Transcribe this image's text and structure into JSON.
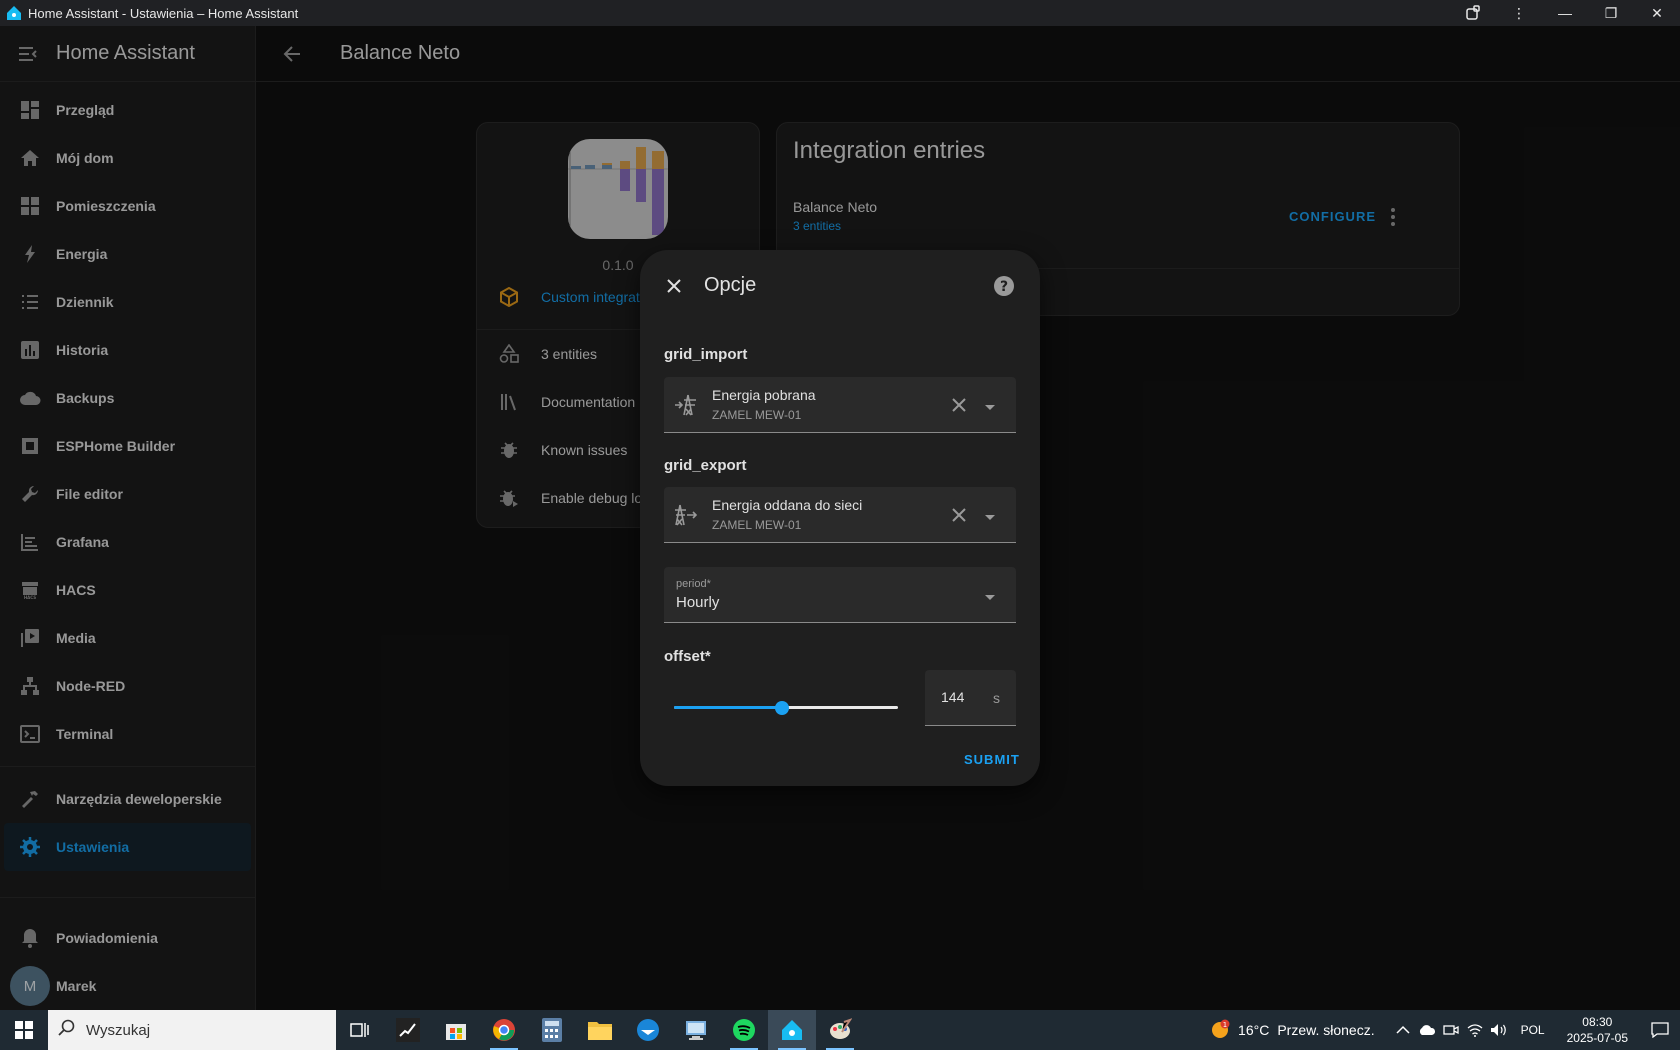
{
  "window": {
    "title": "Home Assistant - Ustawienia – Home Assistant"
  },
  "sidebar": {
    "title": "Home Assistant",
    "items": [
      {
        "label": "Przegląd",
        "icon": "dashboard-icon"
      },
      {
        "label": "Mój dom",
        "icon": "home-icon"
      },
      {
        "label": "Pomieszczenia",
        "icon": "areas-icon"
      },
      {
        "label": "Energia",
        "icon": "lightning-icon"
      },
      {
        "label": "Dziennik",
        "icon": "logbook-icon"
      },
      {
        "label": "Historia",
        "icon": "history-chart-icon"
      },
      {
        "label": "Backups",
        "icon": "cloud-icon"
      },
      {
        "label": "ESPHome Builder",
        "icon": "chip-icon"
      },
      {
        "label": "File editor",
        "icon": "wrench-icon"
      },
      {
        "label": "Grafana",
        "icon": "grafana-icon"
      },
      {
        "label": "HACS",
        "icon": "hacs-icon"
      },
      {
        "label": "Media",
        "icon": "media-icon"
      },
      {
        "label": "Node-RED",
        "icon": "sitemap-icon"
      },
      {
        "label": "Terminal",
        "icon": "terminal-icon"
      }
    ],
    "developer_tools": "Narzędzia deweloperskie",
    "settings": "Ustawienia",
    "notifications": "Powiadomienia",
    "user_name": "Marek",
    "user_initial": "M"
  },
  "header": {
    "page_title": "Balance Neto"
  },
  "info_card": {
    "version": "0.1.0",
    "custom_integration": "Custom integrat",
    "entities": "3 entities",
    "documentation": "Documentation",
    "known_issues": "Known issues",
    "debug": "Enable debug lo"
  },
  "entries_card": {
    "title": "Integration entries",
    "entry_name": "Balance Neto",
    "entry_entities": "3 entities",
    "configure": "CONFIGURE"
  },
  "dialog": {
    "title": "Opcje",
    "grid_import_label": "grid_import",
    "grid_import": {
      "name": "Energia pobrana",
      "device": "ZAMEL MEW-01"
    },
    "grid_export_label": "grid_export",
    "grid_export": {
      "name": "Energia oddana do sieci",
      "device": "ZAMEL MEW-01"
    },
    "period_label": "period*",
    "period_value": "Hourly",
    "offset_label": "offset*",
    "offset_value": "144",
    "offset_unit": "s",
    "offset_fraction": 0.48,
    "submit": "SUBMIT"
  },
  "taskbar": {
    "search_placeholder": "Wyszukaj",
    "weather_temp": "16°C",
    "weather_desc": "Przew. słonecz.",
    "weather_badge": "1",
    "language": "POL",
    "time": "08:30",
    "date": "2025-07-05"
  },
  "colors": {
    "accent": "#1ba1f2",
    "orange": "#e39a1c"
  }
}
